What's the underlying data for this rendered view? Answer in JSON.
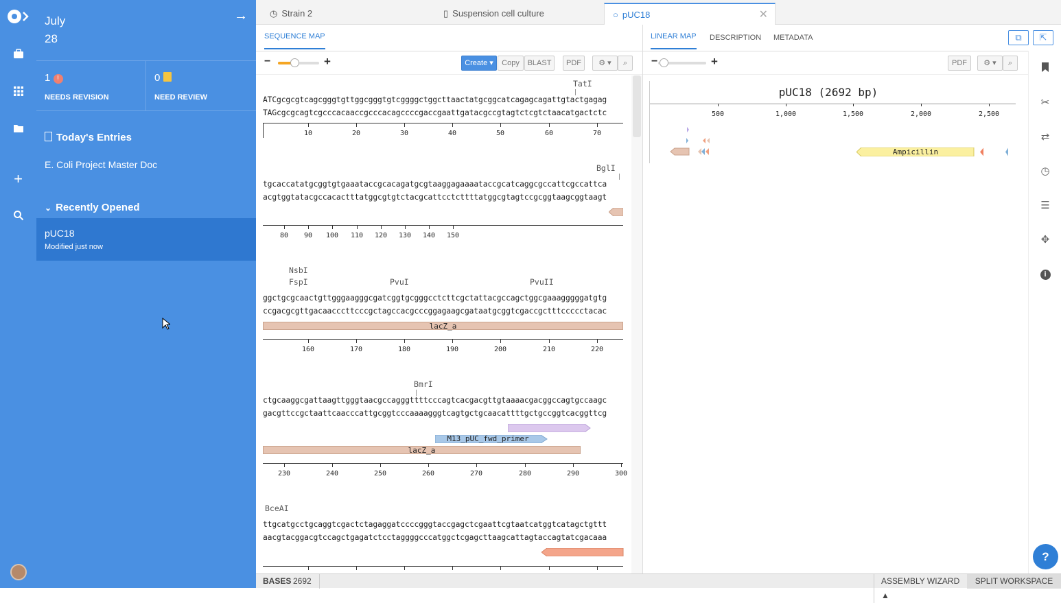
{
  "sidebar": {
    "date_month": "July",
    "date_day": "28",
    "needs_revision": {
      "count": "1",
      "label": "NEEDS REVISION"
    },
    "need_review": {
      "count": "0",
      "label": "NEED REVIEW"
    },
    "todays_entries": "Today's Entries",
    "entry": "E. Coli Project Master Doc",
    "recently_opened": "Recently Opened",
    "recent": {
      "title": "pUC18",
      "subtitle": "Modified just now"
    }
  },
  "tabs": [
    "Strain 2",
    "Suspension cell culture",
    "pUC18"
  ],
  "left": {
    "tab": "SEQUENCE MAP",
    "btn_create": "Create",
    "btn_copy": "Copy",
    "btn_blast": "BLAST",
    "btn_pdf": "PDF",
    "blocks": [
      {
        "top": "ATCgcgcgtcagcgggtgttggcgggtgtcggggctggcttaactatgcggcatcagagcagattgtactgagag",
        "bottom": "TAGcgcgcagtcgcccacaaccgcccacagccccgaccgaattgatacgccgtagtctcgtctaacatgactctc",
        "enzymes": [
          "TatI"
        ],
        "ticks": [
          "10",
          "20",
          "30",
          "40",
          "50",
          "60",
          "70"
        ]
      },
      {
        "top": "tgcaccatatgcggtgtgaaataccgcacagatgcgtaaggagaaaataccgcatcaggcgccattcgccattca",
        "bottom": "acgtggtatacgccacactttatggcgtgtctacgcattcctcttttatggcgtagtccgcggtaagcggtaagt",
        "enzymes": [
          "BglI"
        ],
        "ticks": [
          "80",
          "90",
          "100",
          "110",
          "120",
          "130",
          "140",
          "150"
        ]
      },
      {
        "top": "ggctgcgcaactgttgggaagggcgatcggtgcgggcctcttcgctattacgccagctggcgaaagggggatgtg",
        "bottom": "ccgacgcgttgacaacccttcccgctagccacgcccggagaagcgataatgcggtcgaccgctttccccctacac",
        "enzymes": [
          "NsbI",
          "FspI",
          "PvuI",
          "PvuII"
        ],
        "feature": "lacZ_a",
        "ticks": [
          "160",
          "170",
          "180",
          "190",
          "200",
          "210",
          "220"
        ]
      },
      {
        "top": "ctgcaaggcgattaagttgggtaacgccagggttttcccagtcacgacgttgtaaaacgacggccagtgccaagc",
        "bottom": "gacgttccgctaattcaacccattgcggtcccaaaagggtcagtgctgcaacattttgctgccggtcacggttcg",
        "enzymes": [
          "BmrI"
        ],
        "primer": "M13_pUC_fwd_primer",
        "feature": "lacZ_a",
        "ticks": [
          "230",
          "240",
          "250",
          "260",
          "270",
          "280",
          "290",
          "300"
        ]
      },
      {
        "top": "ttgcatgcctgcaggtcgactctagaggatccccgggtaccgagctcgaattcgtaatcatggtcatagctgttt",
        "bottom": "aacgtacggacgtccagctgagatctcctaggggcccatggctcgagcttaagcattagtaccagtatcgacaaa",
        "enzymes": [
          "BceAI"
        ]
      }
    ]
  },
  "right": {
    "tabs": [
      "LINEAR MAP",
      "DESCRIPTION",
      "METADATA"
    ],
    "btn_pdf": "PDF",
    "map_title": "pUC18 (2692 bp)",
    "axis": [
      "500",
      "1,000",
      "1,500",
      "2,000",
      "2,500"
    ],
    "feature": "Ampicillin"
  },
  "status": {
    "bases_label": "BASES",
    "bases": "2692",
    "assembly": "ASSEMBLY WIZARD ▲",
    "split": "SPLIT WORKSPACE"
  },
  "colors": {
    "accent": "#4a90e2",
    "lacz": "#e6c4b2",
    "primer": "#a8c8e8",
    "amp": "#fbf0a0"
  }
}
